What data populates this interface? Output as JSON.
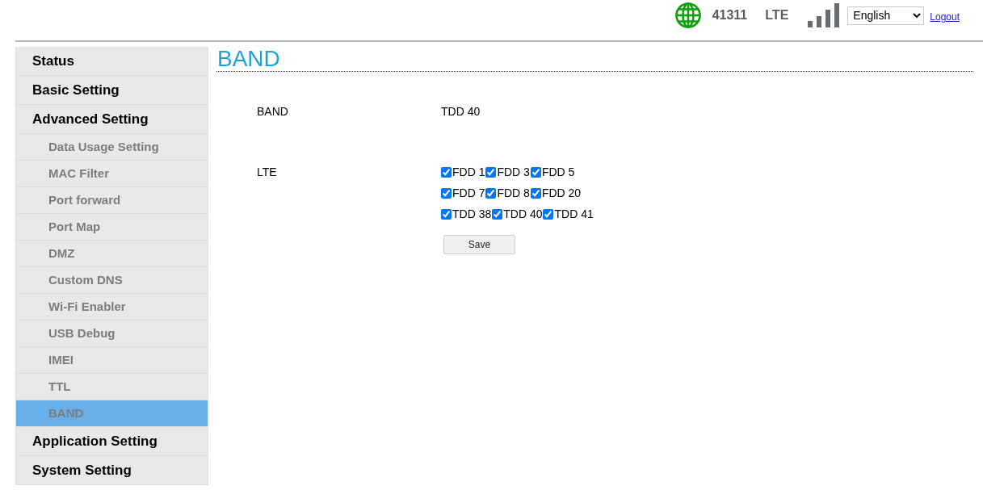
{
  "header": {
    "network_code": "41311",
    "network_type": "LTE",
    "language": "English",
    "logout": "Logout"
  },
  "sidebar": {
    "items": [
      {
        "label": "Status",
        "selected": false
      },
      {
        "label": "Basic Setting",
        "selected": false
      },
      {
        "label": "Advanced Setting",
        "selected": false,
        "children": [
          {
            "label": "Data Usage Setting",
            "selected": false
          },
          {
            "label": "MAC Filter",
            "selected": false
          },
          {
            "label": "Port forward",
            "selected": false
          },
          {
            "label": "Port Map",
            "selected": false
          },
          {
            "label": "DMZ",
            "selected": false
          },
          {
            "label": "Custom DNS",
            "selected": false
          },
          {
            "label": "Wi-Fi Enabler",
            "selected": false
          },
          {
            "label": "USB Debug",
            "selected": false
          },
          {
            "label": "IMEI",
            "selected": false
          },
          {
            "label": "TTL",
            "selected": false
          },
          {
            "label": "BAND",
            "selected": true
          }
        ]
      },
      {
        "label": "Application Setting",
        "selected": false
      },
      {
        "label": "System Setting",
        "selected": false
      }
    ]
  },
  "page": {
    "title": "BAND",
    "fields": [
      {
        "kind": "text",
        "label": "BAND",
        "value": "TDD 40"
      },
      {
        "kind": "checkboxes",
        "label": "LTE",
        "rows": [
          {
            "options": [
              {
                "label": "FDD 1",
                "checked": true
              },
              {
                "label": "FDD 3",
                "checked": true
              },
              {
                "label": "FDD 5",
                "checked": true
              }
            ]
          },
          {
            "options": [
              {
                "label": "FDD 7",
                "checked": true
              },
              {
                "label": "FDD 8",
                "checked": true
              },
              {
                "label": "FDD 20",
                "checked": true
              }
            ]
          },
          {
            "options": [
              {
                "label": "TDD 38",
                "checked": true
              },
              {
                "label": "TDD 40",
                "checked": true
              },
              {
                "label": "TDD 41",
                "checked": true
              }
            ]
          }
        ]
      }
    ],
    "save_button": "Save"
  }
}
